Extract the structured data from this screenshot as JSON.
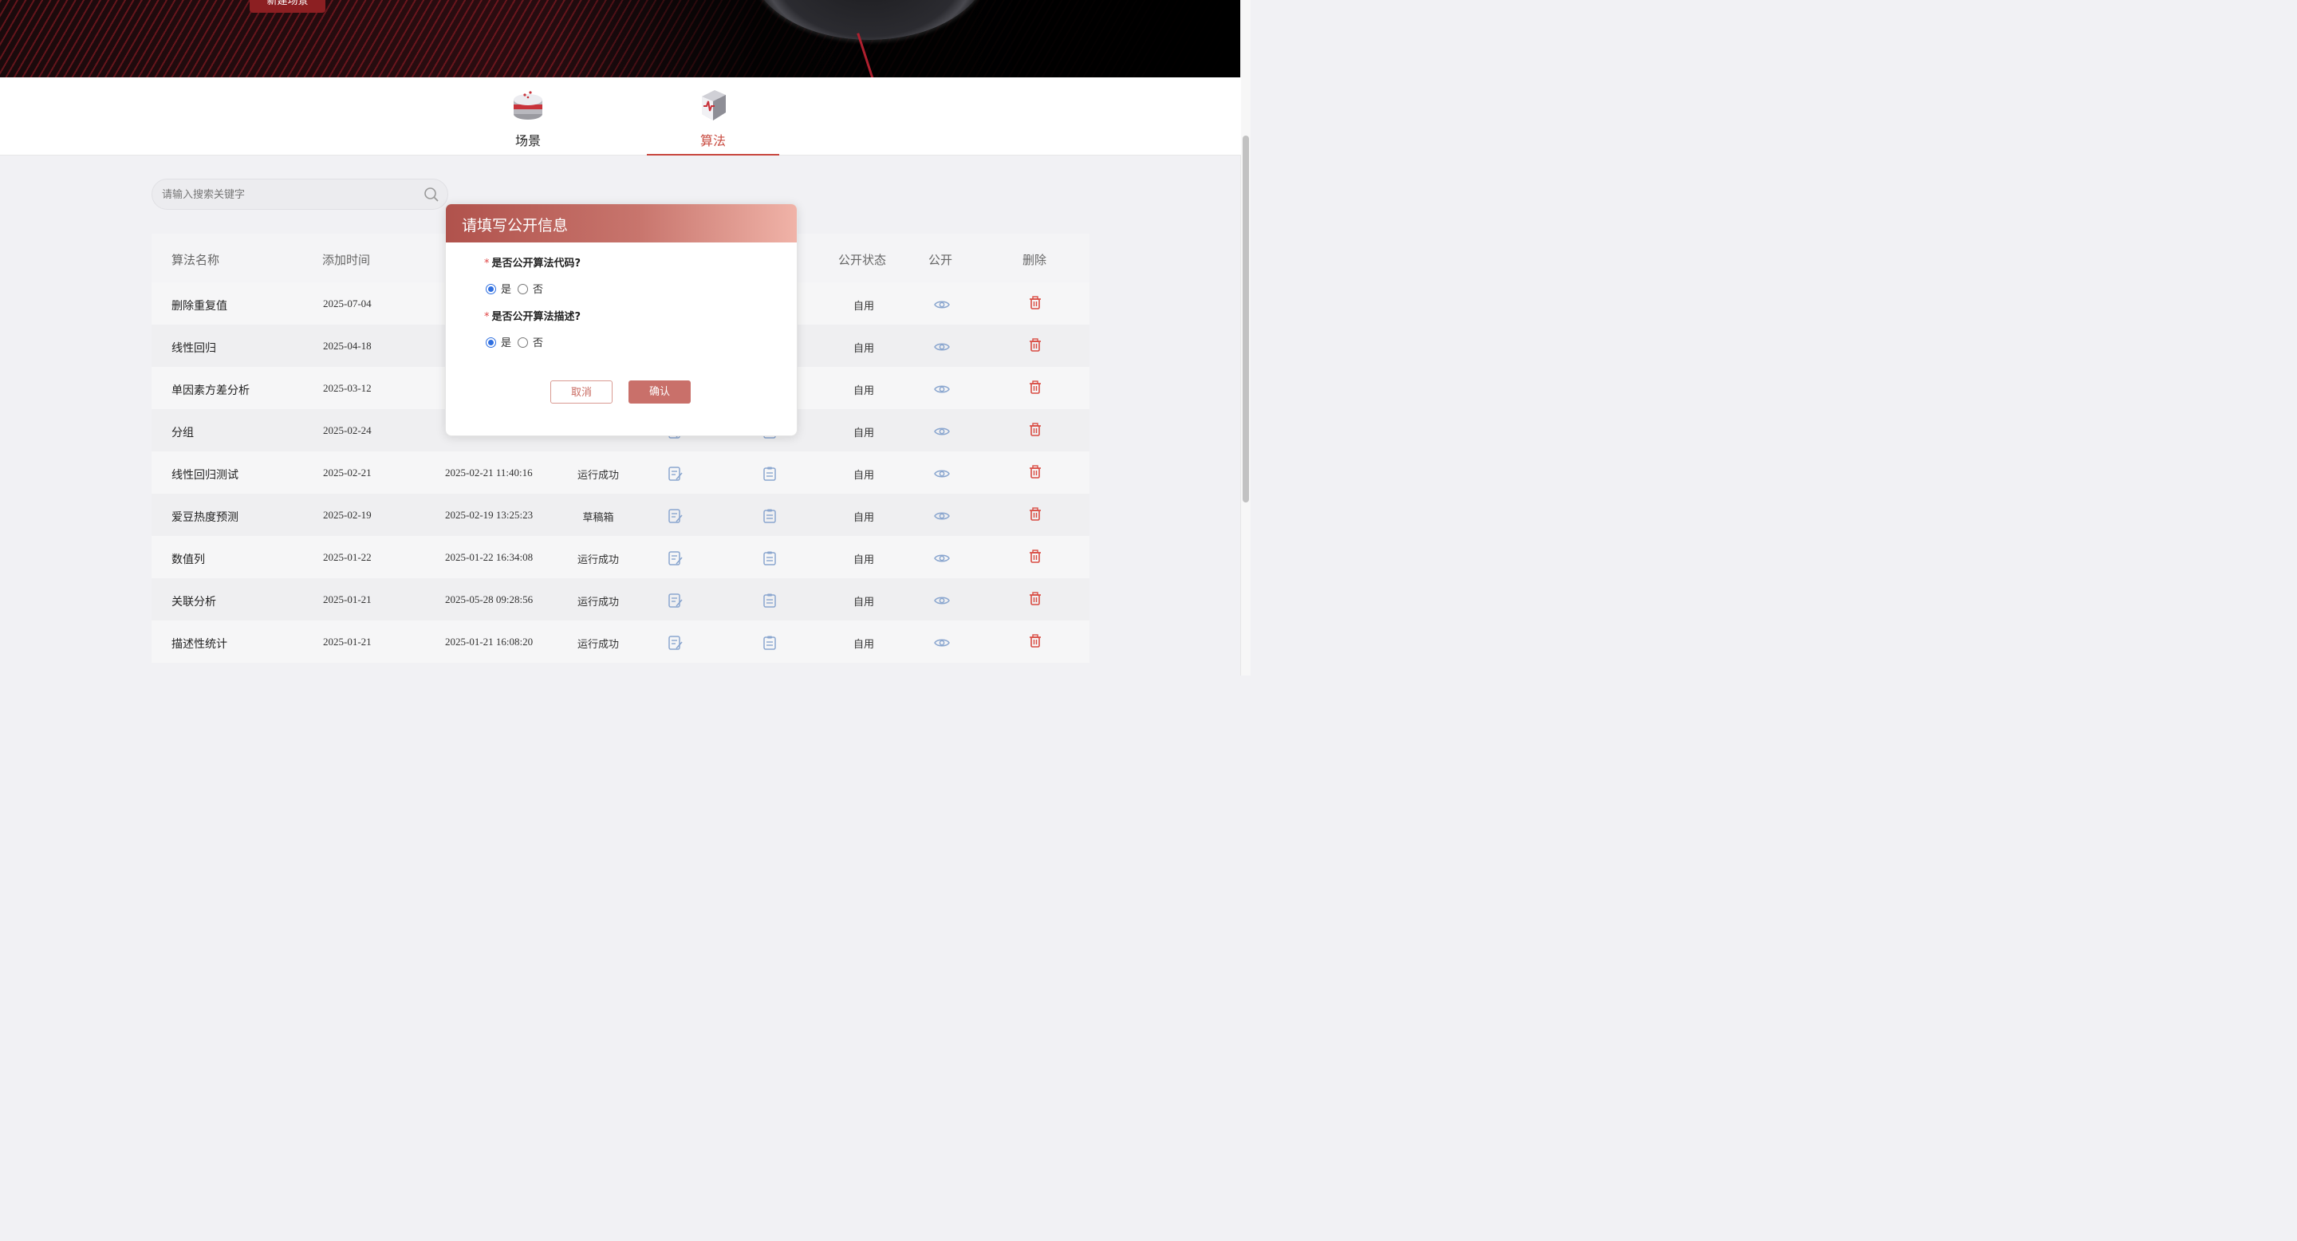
{
  "banner": {
    "new_button": "新建场景"
  },
  "tabs": [
    {
      "label": "场景",
      "active": false,
      "icon": "scene-icon"
    },
    {
      "label": "算法",
      "active": true,
      "icon": "algorithm-icon"
    }
  ],
  "search": {
    "placeholder": "请输入搜索关键字"
  },
  "table": {
    "headers": {
      "name": "算法名称",
      "added": "添加时间",
      "pub_status": "公开状态",
      "public": "公开",
      "delete": "删除"
    },
    "rows": [
      {
        "name": "删除重复值",
        "added": "2025-07-04",
        "updated": "",
        "status": "",
        "pub": "自用"
      },
      {
        "name": "线性回归",
        "added": "2025-04-18",
        "updated": "",
        "status": "",
        "pub": "自用"
      },
      {
        "name": "单因素方差分析",
        "added": "2025-03-12",
        "updated": "",
        "status": "",
        "pub": "自用"
      },
      {
        "name": "分组",
        "added": "2025-02-24",
        "updated": "",
        "status": "",
        "pub": "自用"
      },
      {
        "name": "线性回归测试",
        "added": "2025-02-21",
        "updated": "2025-02-21 11:40:16",
        "status": "运行成功",
        "pub": "自用"
      },
      {
        "name": "爱豆热度预测",
        "added": "2025-02-19",
        "updated": "2025-02-19 13:25:23",
        "status": "草稿箱",
        "pub": "自用"
      },
      {
        "name": "数值列",
        "added": "2025-01-22",
        "updated": "2025-01-22 16:34:08",
        "status": "运行成功",
        "pub": "自用"
      },
      {
        "name": "关联分析",
        "added": "2025-01-21",
        "updated": "2025-05-28 09:28:56",
        "status": "运行成功",
        "pub": "自用"
      },
      {
        "name": "描述性统计",
        "added": "2025-01-21",
        "updated": "2025-01-21 16:08:20",
        "status": "运行成功",
        "pub": "自用"
      }
    ]
  },
  "dialog": {
    "title": "请填写公开信息",
    "q1": {
      "required_mark": "*",
      "label": "是否公开算法代码?",
      "yes": "是",
      "no": "否",
      "selected": "是"
    },
    "q2": {
      "required_mark": "*",
      "label": "是否公开算法描述?",
      "yes": "是",
      "no": "否",
      "selected": "是"
    },
    "cancel": "取消",
    "confirm": "确认"
  },
  "colors": {
    "accent": "#c8463d",
    "radio": "#2f6fe0",
    "confirm_bg": "#c9706a"
  }
}
